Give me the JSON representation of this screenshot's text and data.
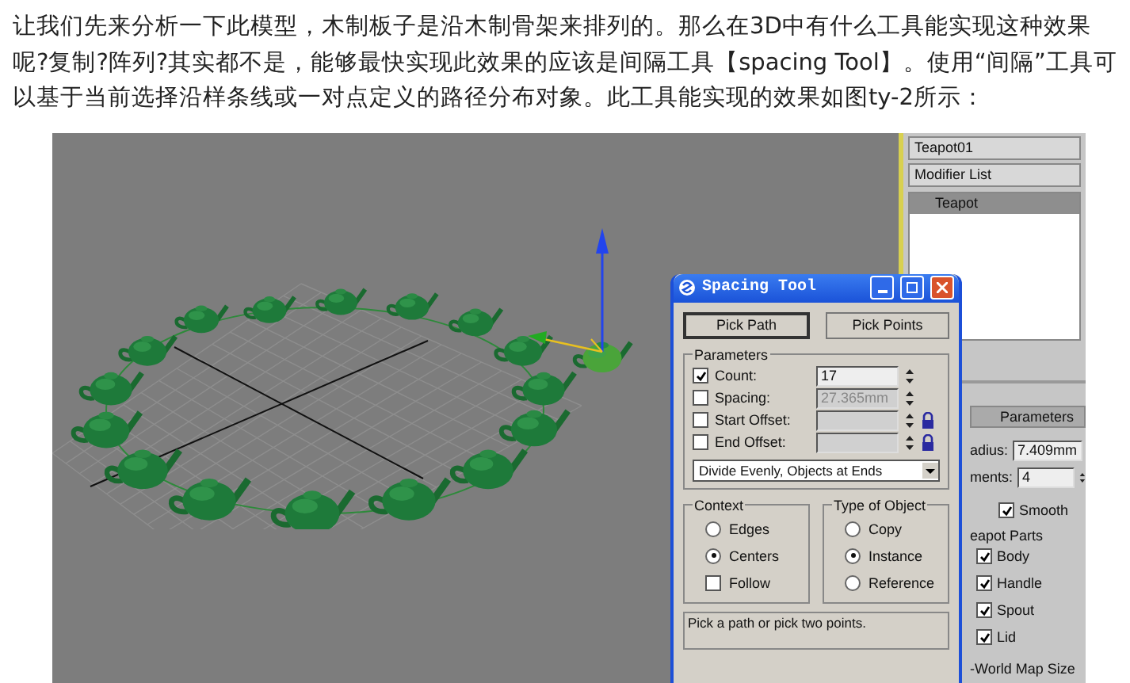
{
  "article": {
    "paragraph": "让我们先来分析一下此模型，木制板子是沿木制骨架来排列的。那么在3D中有什么工具能实现这种效果呢?复制?阵列?其实都不是，能够最快实现此效果的应该是间隔工具【spacing Tool】。使用“间隔”工具可以基于当前选择沿样条线或一对点定义的路径分布对象。此工具能实现的效果如图ty-2所示："
  },
  "command_panel": {
    "object_name": "Teapot01",
    "modifier_list": "Modifier List",
    "stack": [
      {
        "label": "Teapot",
        "selected": true
      }
    ],
    "rollout_title": "Parameters",
    "fields": [
      {
        "label": "adius:",
        "value": "7.409mm"
      },
      {
        "label": "ments:",
        "value": "4"
      }
    ],
    "smooth": {
      "label": "Smooth",
      "checked": true
    },
    "group_title": "eapot Parts",
    "parts": [
      {
        "label": "Body",
        "checked": true
      },
      {
        "label": "Handle",
        "checked": true
      },
      {
        "label": "Spout",
        "checked": true
      },
      {
        "label": "Lid",
        "checked": true
      }
    ],
    "footer": "-World Map Size"
  },
  "dialog": {
    "title": "Spacing Tool",
    "buttons": [
      {
        "label": "Pick Path",
        "selected": true
      },
      {
        "label": "Pick Points",
        "selected": false
      }
    ],
    "parameters": {
      "title": "Parameters",
      "rows": [
        {
          "label": "Count:",
          "checked": true,
          "value": "17",
          "disabled": false,
          "lock": false
        },
        {
          "label": "Spacing:",
          "checked": false,
          "value": "27.365mm",
          "disabled": true,
          "lock": false
        },
        {
          "label": "Start Offset:",
          "checked": false,
          "disabled": true,
          "lock": true
        },
        {
          "label": "End Offset:",
          "checked": false,
          "disabled": true,
          "lock": true
        }
      ],
      "mode": "Divide Evenly, Objects at Ends"
    },
    "context": {
      "title": "Context",
      "options": [
        {
          "label": "Edges",
          "selected": false
        },
        {
          "label": "Centers",
          "selected": true
        }
      ],
      "follow": {
        "label": "Follow",
        "checked": false
      }
    },
    "type_of_object": {
      "title": "Type of Object",
      "options": [
        {
          "label": "Copy",
          "selected": false
        },
        {
          "label": "Instance",
          "selected": true
        },
        {
          "label": "Reference",
          "selected": false
        }
      ]
    },
    "status": "Pick a path or pick two points."
  }
}
